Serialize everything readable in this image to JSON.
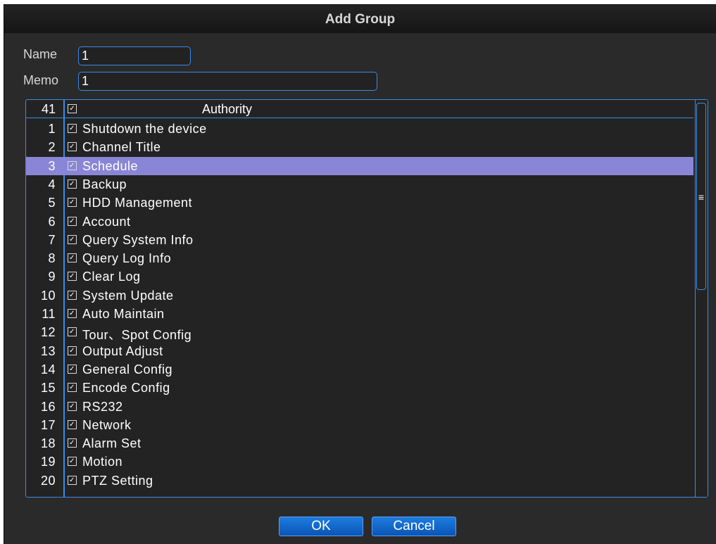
{
  "dialog": {
    "title": "Add Group"
  },
  "form": {
    "name_label": "Name",
    "name_value": "1",
    "memo_label": "Memo",
    "memo_value": "1"
  },
  "authority_list": {
    "header_count": "41",
    "header_checked": true,
    "header_label": "Authority",
    "selected_index": 2,
    "rows": [
      {
        "num": "1",
        "checked": true,
        "label": "Shutdown the device"
      },
      {
        "num": "2",
        "checked": true,
        "label": "Channel Title"
      },
      {
        "num": "3",
        "checked": true,
        "label": "Schedule"
      },
      {
        "num": "4",
        "checked": true,
        "label": "Backup"
      },
      {
        "num": "5",
        "checked": true,
        "label": "HDD Management"
      },
      {
        "num": "6",
        "checked": true,
        "label": "Account"
      },
      {
        "num": "7",
        "checked": true,
        "label": "Query System Info"
      },
      {
        "num": "8",
        "checked": true,
        "label": "Query Log Info"
      },
      {
        "num": "9",
        "checked": true,
        "label": "Clear Log"
      },
      {
        "num": "10",
        "checked": true,
        "label": "System Update"
      },
      {
        "num": "11",
        "checked": true,
        "label": "Auto Maintain"
      },
      {
        "num": "12",
        "checked": true,
        "label": "Tour、Spot Config"
      },
      {
        "num": "13",
        "checked": true,
        "label": "Output Adjust"
      },
      {
        "num": "14",
        "checked": true,
        "label": "General Config"
      },
      {
        "num": "15",
        "checked": true,
        "label": "Encode Config"
      },
      {
        "num": "16",
        "checked": true,
        "label": "RS232"
      },
      {
        "num": "17",
        "checked": true,
        "label": "Network"
      },
      {
        "num": "18",
        "checked": true,
        "label": "Alarm Set"
      },
      {
        "num": "19",
        "checked": true,
        "label": "Motion"
      },
      {
        "num": "20",
        "checked": true,
        "label": "PTZ Setting"
      }
    ]
  },
  "buttons": {
    "ok_label": "OK",
    "cancel_label": "Cancel"
  },
  "colors": {
    "accent_border": "#3c8ae6",
    "selected_row": "#8a86d6",
    "button_fill": "#0f66cc",
    "background": "#2a2a2a"
  }
}
